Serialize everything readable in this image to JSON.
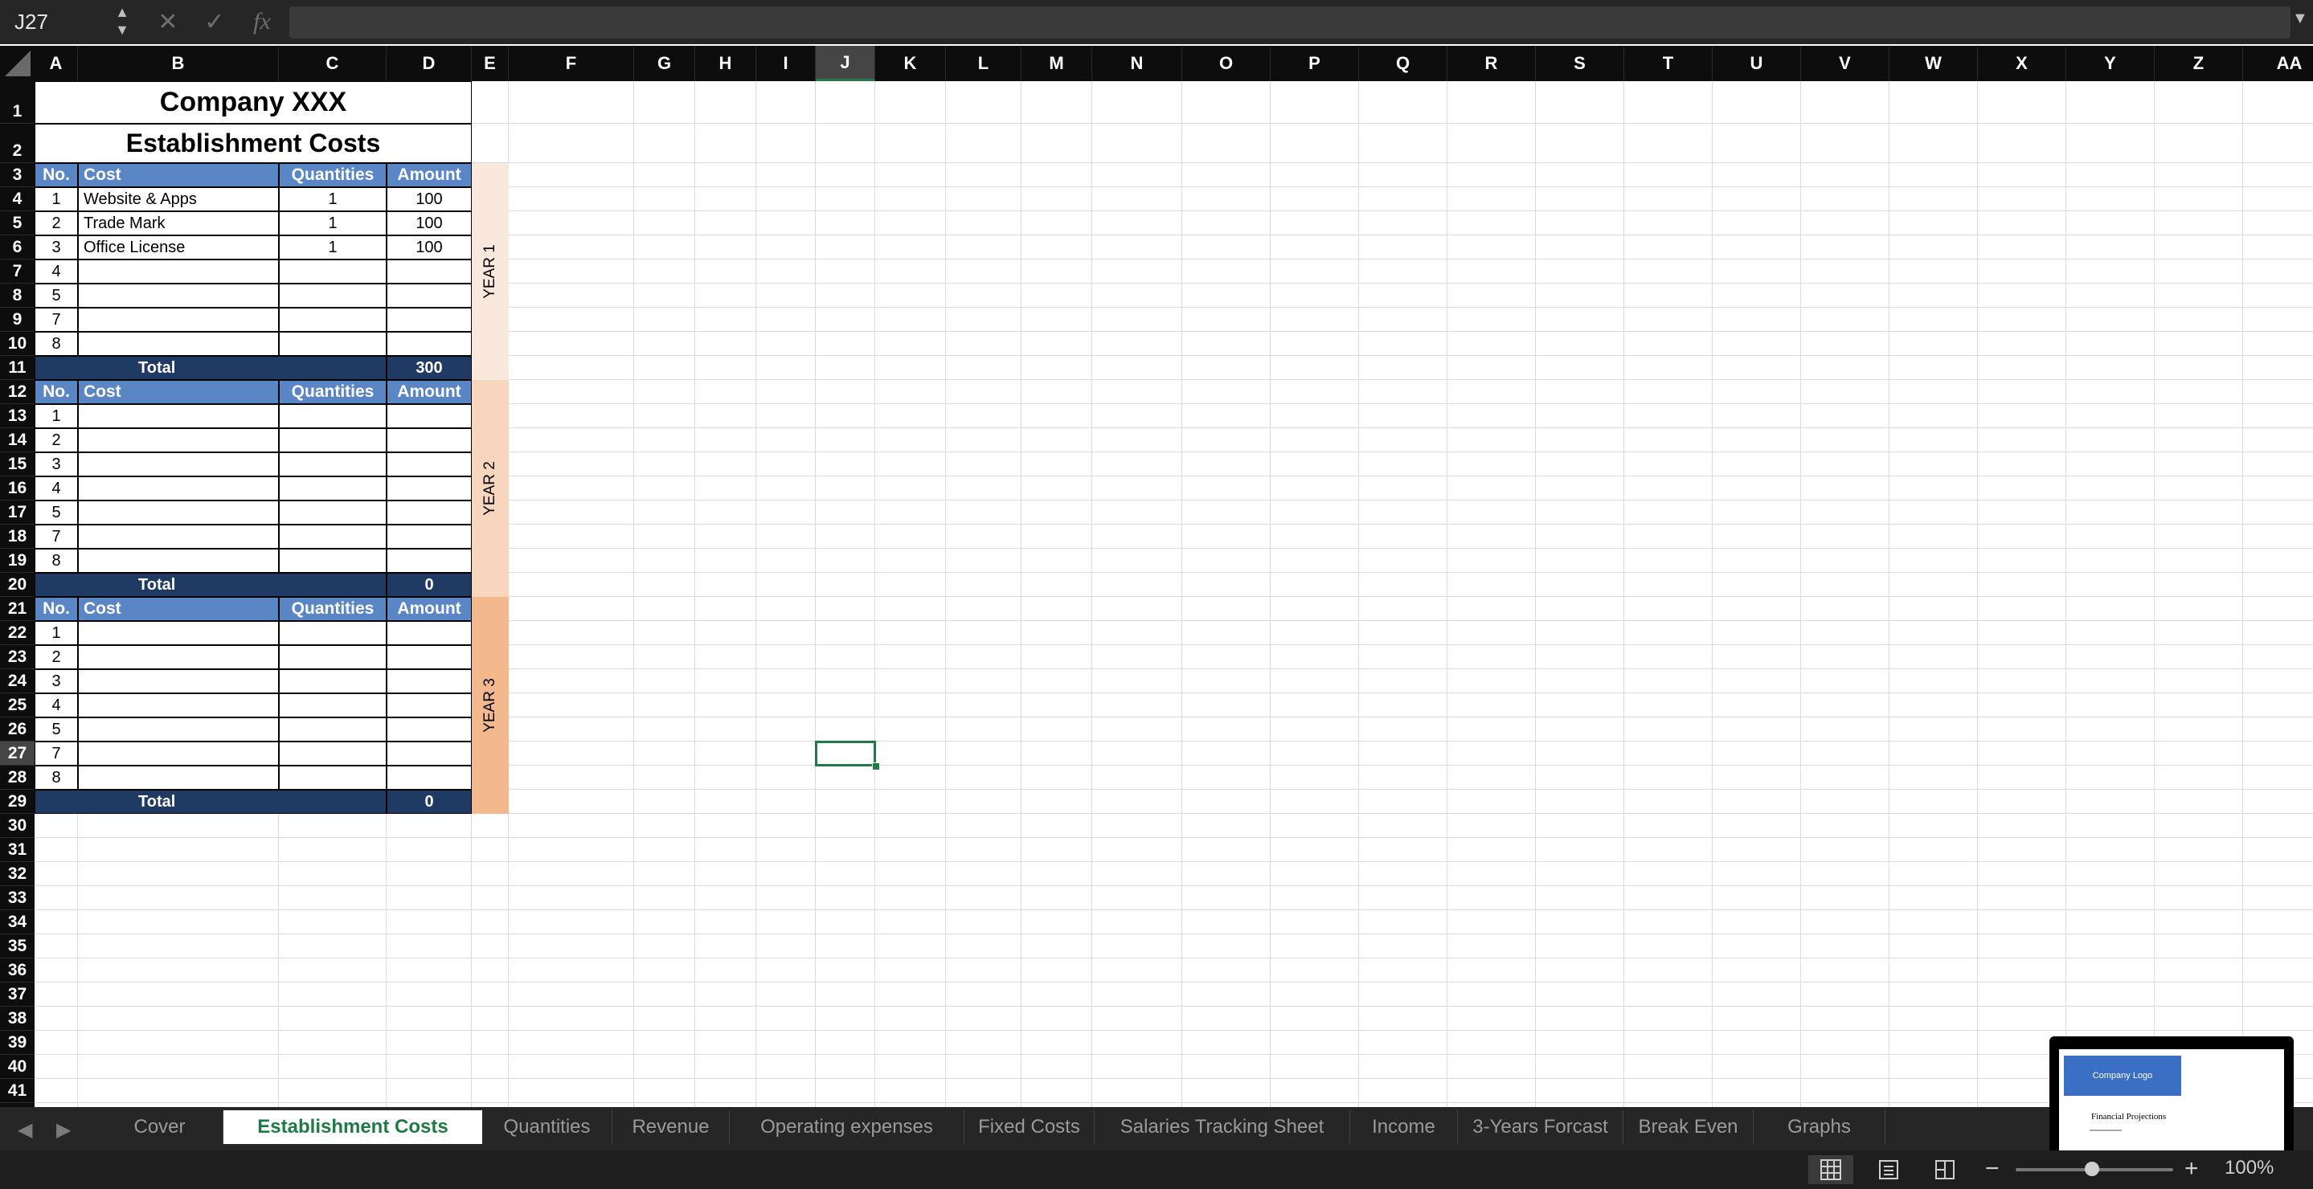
{
  "formula_bar": {
    "name_box": "J27",
    "cancel_icon": "✕",
    "enter_icon": "✓",
    "fx_label": "fx",
    "formula_value": ""
  },
  "columns": [
    "A",
    "B",
    "C",
    "D",
    "E",
    "F",
    "G",
    "H",
    "I",
    "J",
    "K",
    "L",
    "M",
    "N",
    "O",
    "P",
    "Q",
    "R",
    "S",
    "T",
    "U",
    "V",
    "W",
    "X",
    "Y",
    "Z",
    "AA"
  ],
  "selected_column": "J",
  "rows": [
    "1",
    "2",
    "3",
    "4",
    "5",
    "6",
    "7",
    "8",
    "9",
    "10",
    "11",
    "12",
    "13",
    "14",
    "15",
    "16",
    "17",
    "18",
    "19",
    "20",
    "21",
    "22",
    "23",
    "24",
    "25",
    "26",
    "27",
    "28",
    "29",
    "30",
    "31",
    "32",
    "33",
    "34",
    "35",
    "36",
    "37",
    "38",
    "39",
    "40",
    "41"
  ],
  "selected_row": "27",
  "sheet": {
    "title": "Company XXX",
    "subtitle": "Establishment  Costs",
    "header": {
      "no": "No.",
      "cost": "Cost",
      "quantities": "Quantities",
      "amount": "Amount"
    },
    "total_label": "Total",
    "sections": [
      {
        "year_label": "YEAR 1",
        "band_color": "#fbe8dc",
        "items": [
          {
            "no": "1",
            "cost": "Website & Apps",
            "qty": "1",
            "amount": "100"
          },
          {
            "no": "2",
            "cost": "Trade Mark",
            "qty": "1",
            "amount": "100"
          },
          {
            "no": "3",
            "cost": "Office License",
            "qty": "1",
            "amount": "100"
          },
          {
            "no": "4",
            "cost": "",
            "qty": "",
            "amount": ""
          },
          {
            "no": "5",
            "cost": "",
            "qty": "",
            "amount": ""
          },
          {
            "no": "7",
            "cost": "",
            "qty": "",
            "amount": ""
          },
          {
            "no": "8",
            "cost": "",
            "qty": "",
            "amount": ""
          }
        ],
        "total": "300"
      },
      {
        "year_label": "YEAR 2",
        "band_color": "#f8d5bd",
        "items": [
          {
            "no": "1",
            "cost": "",
            "qty": "",
            "amount": ""
          },
          {
            "no": "2",
            "cost": "",
            "qty": "",
            "amount": ""
          },
          {
            "no": "3",
            "cost": "",
            "qty": "",
            "amount": ""
          },
          {
            "no": "4",
            "cost": "",
            "qty": "",
            "amount": ""
          },
          {
            "no": "5",
            "cost": "",
            "qty": "",
            "amount": ""
          },
          {
            "no": "7",
            "cost": "",
            "qty": "",
            "amount": ""
          },
          {
            "no": "8",
            "cost": "",
            "qty": "",
            "amount": ""
          }
        ],
        "total": "0"
      },
      {
        "year_label": "YEAR 3",
        "band_color": "#f3b98d",
        "items": [
          {
            "no": "1",
            "cost": "",
            "qty": "",
            "amount": ""
          },
          {
            "no": "2",
            "cost": "",
            "qty": "",
            "amount": ""
          },
          {
            "no": "3",
            "cost": "",
            "qty": "",
            "amount": ""
          },
          {
            "no": "4",
            "cost": "",
            "qty": "",
            "amount": ""
          },
          {
            "no": "5",
            "cost": "",
            "qty": "",
            "amount": ""
          },
          {
            "no": "7",
            "cost": "",
            "qty": "",
            "amount": ""
          },
          {
            "no": "8",
            "cost": "",
            "qty": "",
            "amount": ""
          }
        ],
        "total": "0"
      }
    ]
  },
  "tabs": [
    {
      "label": "Cover",
      "active": false
    },
    {
      "label": "Establishment  Costs",
      "active": true
    },
    {
      "label": "Quantities",
      "active": false
    },
    {
      "label": "Revenue",
      "active": false
    },
    {
      "label": "Operating expenses",
      "active": false
    },
    {
      "label": "Fixed Costs",
      "active": false
    },
    {
      "label": "Salaries Tracking Sheet",
      "active": false
    },
    {
      "label": "Income",
      "active": false
    },
    {
      "label": "3-Years Forcast",
      "active": false
    },
    {
      "label": "Break Even",
      "active": false
    },
    {
      "label": "Graphs",
      "active": false
    }
  ],
  "status": {
    "zoom_minus": "−",
    "zoom_plus": "+",
    "zoom_percent": "100%"
  },
  "thumbnail": {
    "logo_text": "Company Logo",
    "title": "Financial Projections"
  },
  "colors": {
    "accent_green": "#1e7b45",
    "header_blue": "#5a86c5",
    "total_navy": "#1f3b63"
  }
}
